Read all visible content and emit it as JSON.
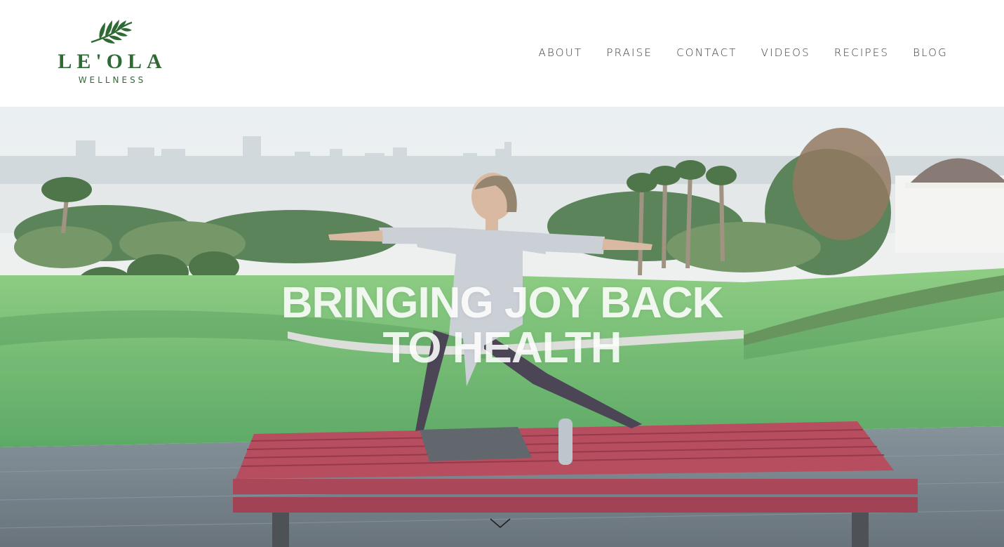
{
  "brand": {
    "name": "LE'OLA",
    "tagline": "WELLNESS",
    "color": "#2f6a35",
    "logo_icon": "leaf-icon"
  },
  "nav": {
    "items": [
      {
        "label": "ABOUT"
      },
      {
        "label": "PRAISE"
      },
      {
        "label": "CONTACT"
      },
      {
        "label": "VIDEOS"
      },
      {
        "label": "RECIPES"
      },
      {
        "label": "BLOG"
      }
    ]
  },
  "hero": {
    "headline_line1": "BRINGING JOY BACK",
    "headline_line2": "TO HEALTH",
    "scroll_icon": "chevron-down-icon"
  }
}
